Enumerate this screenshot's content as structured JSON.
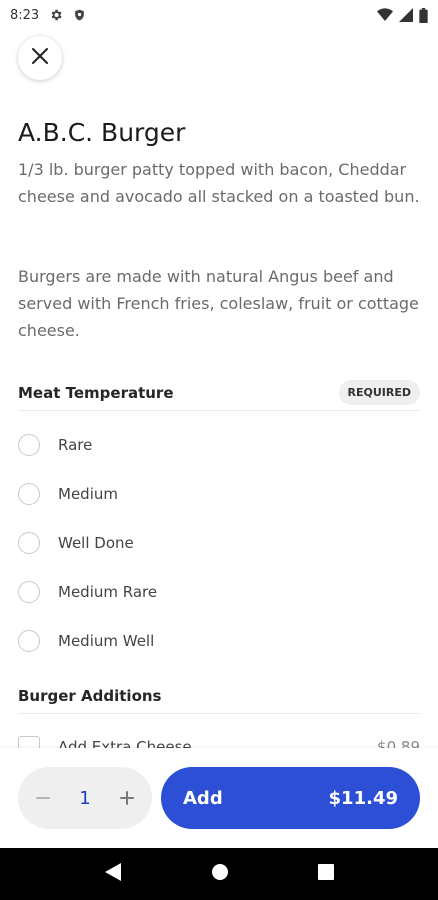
{
  "status_bar": {
    "time": "8:23",
    "icons_left": [
      "gear-icon",
      "shield-icon"
    ],
    "icons_right": [
      "wifi-icon",
      "signal-icon",
      "battery-icon"
    ]
  },
  "close": {
    "icon": "close-icon"
  },
  "item": {
    "title": "A.B.C. Burger",
    "description": "1/3 lb. burger patty topped with bacon, Cheddar cheese and avocado all stacked on a toasted bun.",
    "note": "Burgers are made with natural Angus beef and served with French fries, coleslaw, fruit or cottage cheese."
  },
  "meat_temperature": {
    "title": "Meat Temperature",
    "badge": "REQUIRED",
    "options": [
      "Rare",
      "Medium",
      "Well Done",
      "Medium Rare",
      "Medium Well"
    ]
  },
  "burger_additions": {
    "title": "Burger Additions",
    "options": [
      {
        "label": "Add Extra Cheese",
        "price": "$0.89"
      }
    ]
  },
  "bottom_bar": {
    "quantity": "1",
    "decrement_icon": "minus-icon",
    "increment_icon": "plus-icon",
    "add_label": "Add",
    "add_price": "$11.49"
  },
  "nav_bar": {
    "icons": [
      "back-icon",
      "home-icon",
      "recents-icon"
    ]
  },
  "colors": {
    "accent": "#2d4fd6",
    "quantity_text": "#1d3fbf",
    "nav_background": "#000000"
  }
}
